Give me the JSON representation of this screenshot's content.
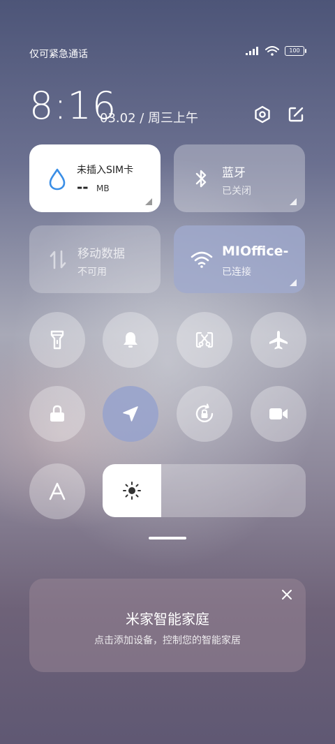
{
  "status_bar": {
    "carrier_text": "仅可紧急通话",
    "battery": "100"
  },
  "header": {
    "time": "8:16",
    "date": "03.02 / 周三上午"
  },
  "tiles": {
    "data_usage": {
      "title": "未插入SIM卡",
      "value": "--",
      "unit": "MB"
    },
    "bluetooth": {
      "title": "蓝牙",
      "status": "已关闭"
    },
    "mobile_data": {
      "title": "移动数据",
      "status": "不可用"
    },
    "wifi": {
      "title": "MIOffice-",
      "status": "已连接"
    }
  },
  "brightness": {
    "level": 0.29
  },
  "mijia_card": {
    "title": "米家智能家庭",
    "subtitle": "点击添加设备，控制您的智能家居"
  },
  "colors": {
    "accent_blue": "#3a8ee6",
    "active_button": "#96a2cd"
  }
}
